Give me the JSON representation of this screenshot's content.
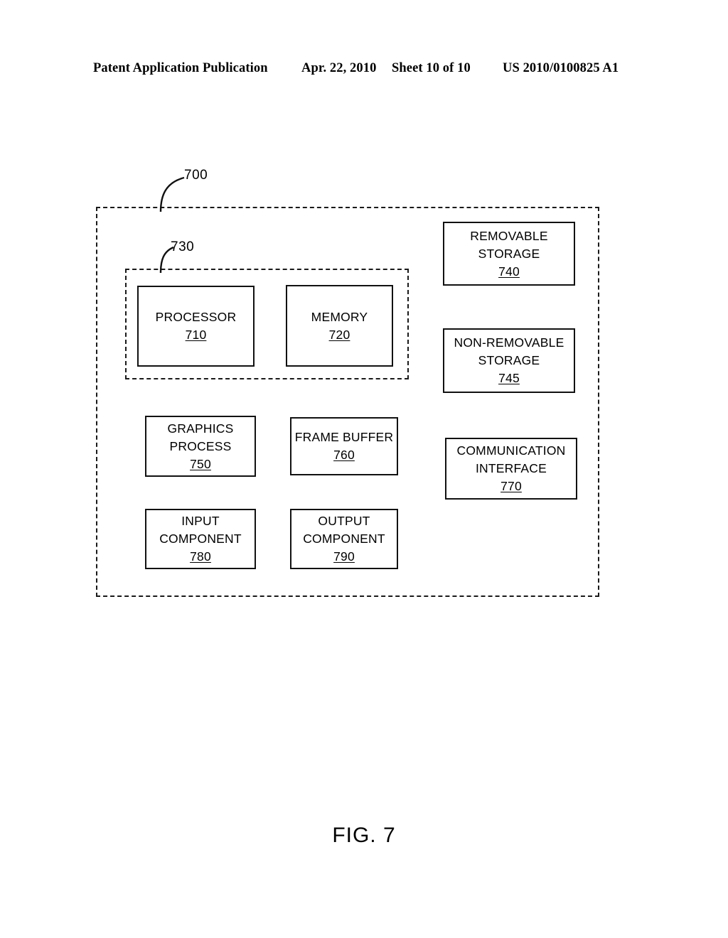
{
  "header": {
    "publication": "Patent Application Publication",
    "date": "Apr. 22, 2010",
    "sheet": "Sheet 10 of 10",
    "publication_number": "US 2010/0100825 A1"
  },
  "figure": {
    "caption": "FIG. 7",
    "system_ref": "700",
    "processing_group_ref": "730",
    "boxes": {
      "processor": {
        "line1": "PROCESSOR",
        "ref": "710"
      },
      "memory": {
        "line1": "MEMORY",
        "ref": "720"
      },
      "removable_storage": {
        "line1": "REMOVABLE",
        "line2": "STORAGE",
        "ref": "740"
      },
      "non_removable_storage": {
        "line1": "NON-REMOVABLE",
        "line2": "STORAGE",
        "ref": "745"
      },
      "graphics_process": {
        "line1": "GRAPHICS",
        "line2": "PROCESS",
        "ref": "750"
      },
      "frame_buffer": {
        "line1": "FRAME BUFFER",
        "ref": "760"
      },
      "communication_interface": {
        "line1": "COMMUNICATION",
        "line2": "INTERFACE",
        "ref": "770"
      },
      "input_component": {
        "line1": "INPUT",
        "line2": "COMPONENT",
        "ref": "780"
      },
      "output_component": {
        "line1": "OUTPUT",
        "line2": "COMPONENT",
        "ref": "790"
      }
    }
  },
  "colors": {
    "ink": "#111111",
    "page": "#ffffff"
  }
}
